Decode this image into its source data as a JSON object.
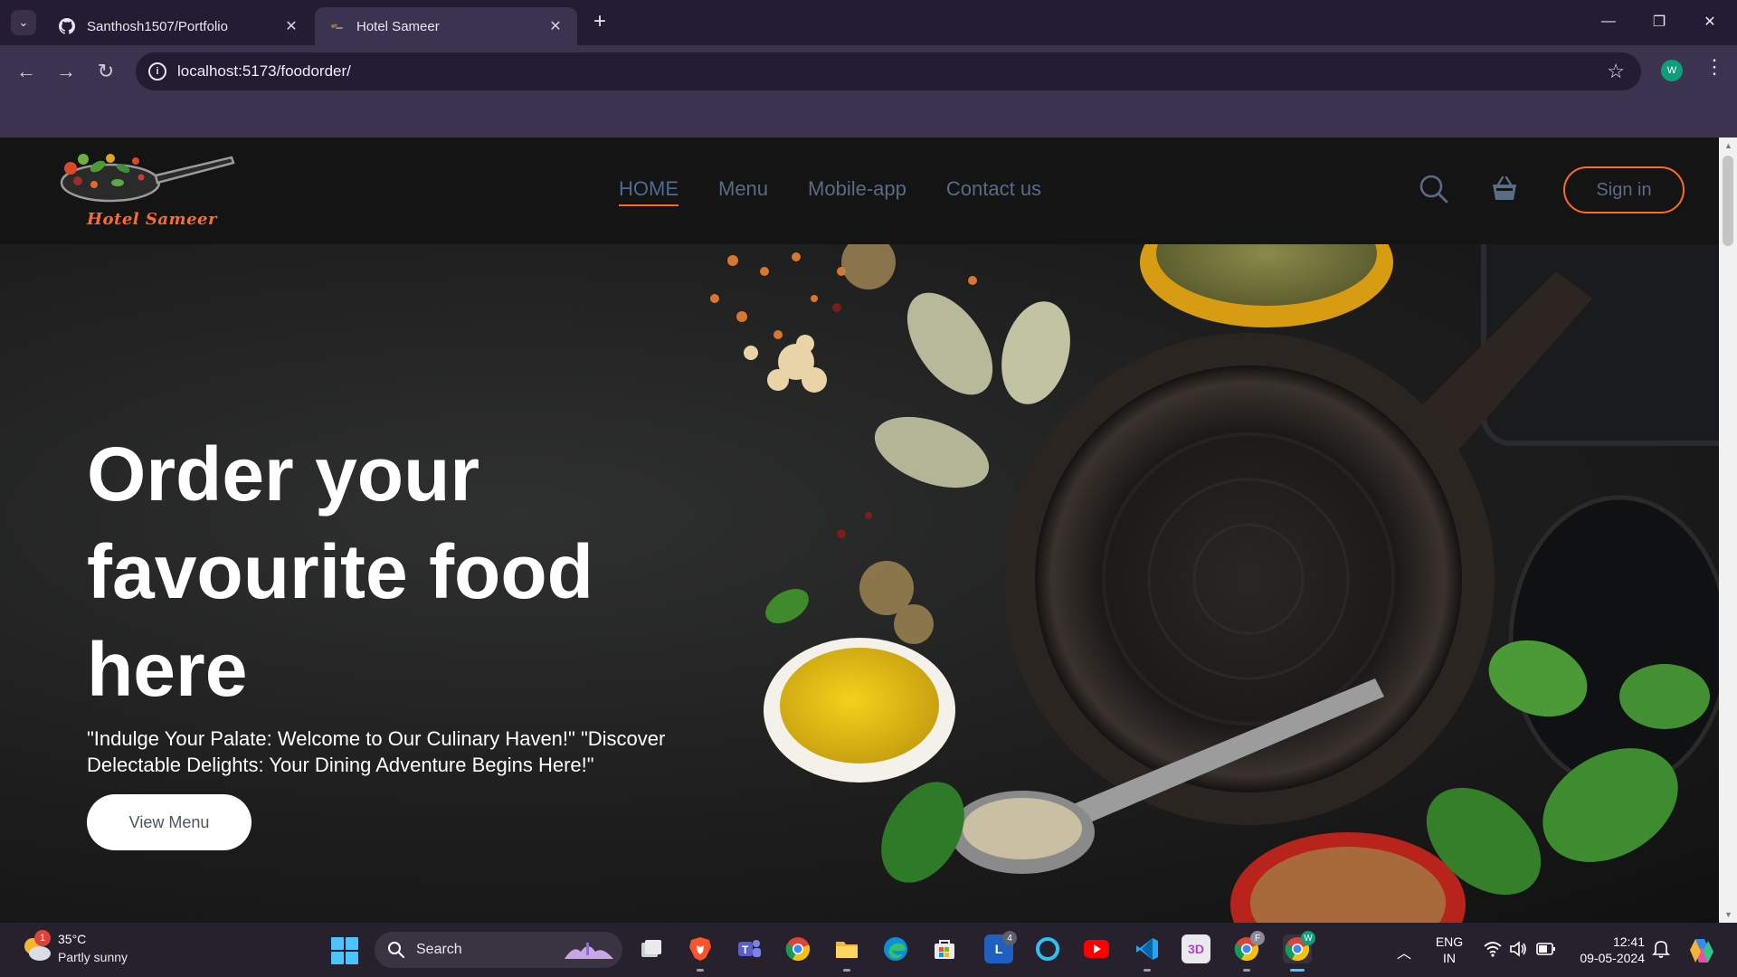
{
  "browser": {
    "tabs": [
      {
        "title": "Santhosh1507/Portfolio",
        "icon": "github-icon",
        "active": false
      },
      {
        "title": "Hotel Sameer",
        "icon": "site-favicon",
        "active": true
      }
    ],
    "address": "localhost:5173/foodorder/",
    "profile_initial": "W"
  },
  "site": {
    "brand": "Hotel Sameer",
    "nav": [
      "HOME",
      "Menu",
      "Mobile-app",
      "Contact us"
    ],
    "active_nav": "HOME",
    "sign_in": "Sign in",
    "colors": {
      "accent": "#ff6a2b",
      "nav_text": "#5a6b84",
      "header_bg": "#141414"
    }
  },
  "hero": {
    "title_lines": [
      "Order your",
      "favourite food",
      "here"
    ],
    "tagline": "\"Indulge Your Palate: Welcome to Our Culinary Haven!\" \"Discover Delectable Delights: Your Dining Adventure Begins Here!\"",
    "cta": "View Menu"
  },
  "taskbar": {
    "weather_badge": "1",
    "temperature": "35°C",
    "weather": "Partly sunny",
    "search_label": "Search",
    "pinned": [
      "task-view",
      "brave",
      "teams",
      "chrome",
      "file-explorer",
      "edge",
      "microsoft-store",
      "app-l",
      "cortana",
      "youtube",
      "vscode",
      "3d-viewer",
      "chrome-profile-f",
      "chrome-profile-w"
    ],
    "l_badge": "4",
    "profile_f_badge": "F",
    "profile_w_badge": "W",
    "lang_top": "ENG",
    "lang_bottom": "IN",
    "time": "12:41",
    "date": "09-05-2024"
  }
}
